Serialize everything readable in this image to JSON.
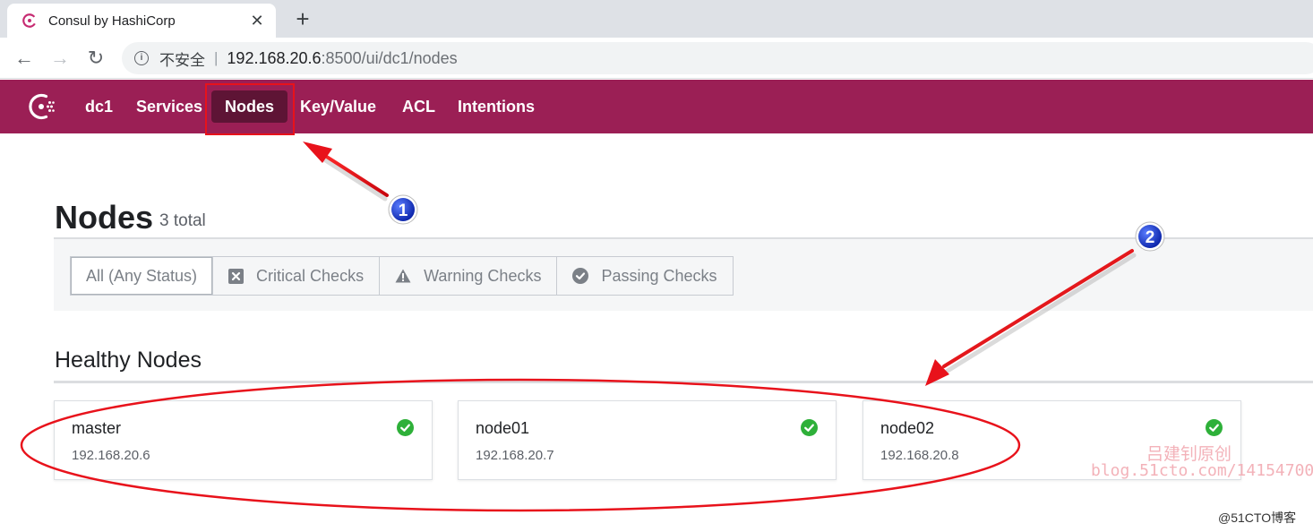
{
  "browser": {
    "tab_title": "Consul by HashiCorp",
    "close_glyph": "✕",
    "new_tab_glyph": "+",
    "back_glyph": "←",
    "forward_glyph": "→",
    "reload_glyph": "↻",
    "security_label": "不安全",
    "separator": "|",
    "url_host": "192.168.20.6",
    "url_rest": ":8500/ui/dc1/nodes"
  },
  "nav": {
    "datacenter": "dc1",
    "items": [
      {
        "label": "Services",
        "active": false
      },
      {
        "label": "Nodes",
        "active": true
      },
      {
        "label": "Key/Value",
        "active": false
      },
      {
        "label": "ACL",
        "active": false
      },
      {
        "label": "Intentions",
        "active": false
      }
    ],
    "brand_color": "#9b1f55"
  },
  "page": {
    "title": "Nodes",
    "count": "3 total"
  },
  "filters": [
    {
      "label": "All (Any Status)",
      "icon": "none",
      "selected": true
    },
    {
      "label": "Critical Checks",
      "icon": "x-square-icon",
      "selected": false
    },
    {
      "label": "Warning Checks",
      "icon": "warning-triangle-icon",
      "selected": false
    },
    {
      "label": "Passing Checks",
      "icon": "check-circle-icon",
      "selected": false
    }
  ],
  "section": {
    "title": "Healthy Nodes"
  },
  "nodes": [
    {
      "name": "master",
      "address": "192.168.20.6",
      "status": "passing"
    },
    {
      "name": "node01",
      "address": "192.168.20.7",
      "status": "passing"
    },
    {
      "name": "node02",
      "address": "192.168.20.8",
      "status": "passing"
    }
  ],
  "annotations": {
    "marker1": "1",
    "marker2": "2",
    "watermark_line1": "吕建钊原创",
    "watermark_line2": "blog.51cto.com/14154700",
    "copyright": "@51CTO博客"
  },
  "colors": {
    "passing": "#2eb039",
    "annotation_red": "#e8121b",
    "marker_blue": "#1337c8"
  }
}
